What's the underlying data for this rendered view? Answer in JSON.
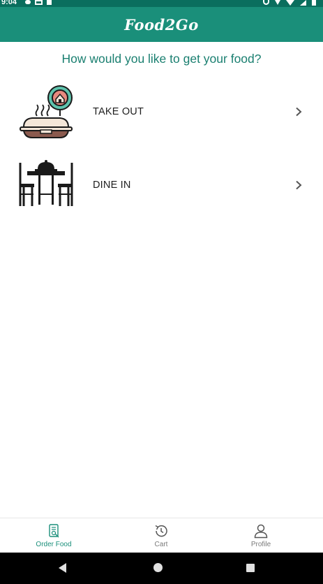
{
  "status_bar": {
    "time": "9:04"
  },
  "app_bar": {
    "title": "Food2Go"
  },
  "main": {
    "prompt": "How would you like to get your food?",
    "options": [
      {
        "label": "TAKE OUT",
        "icon": "takeout-box-icon"
      },
      {
        "label": "DINE IN",
        "icon": "dining-table-icon"
      }
    ]
  },
  "bottom_nav": {
    "items": [
      {
        "label": "Order Food",
        "icon": "order-food-icon",
        "active": true
      },
      {
        "label": "Cart",
        "icon": "history-icon",
        "active": false
      },
      {
        "label": "Profile",
        "icon": "profile-icon",
        "active": false
      }
    ]
  },
  "colors": {
    "app_bar": "#1a8f7a",
    "status_bar": "#0a6e5e",
    "prompt_text": "#1a7f70",
    "active_nav": "#1a8f7a",
    "inactive_nav": "#7a7a7a"
  }
}
